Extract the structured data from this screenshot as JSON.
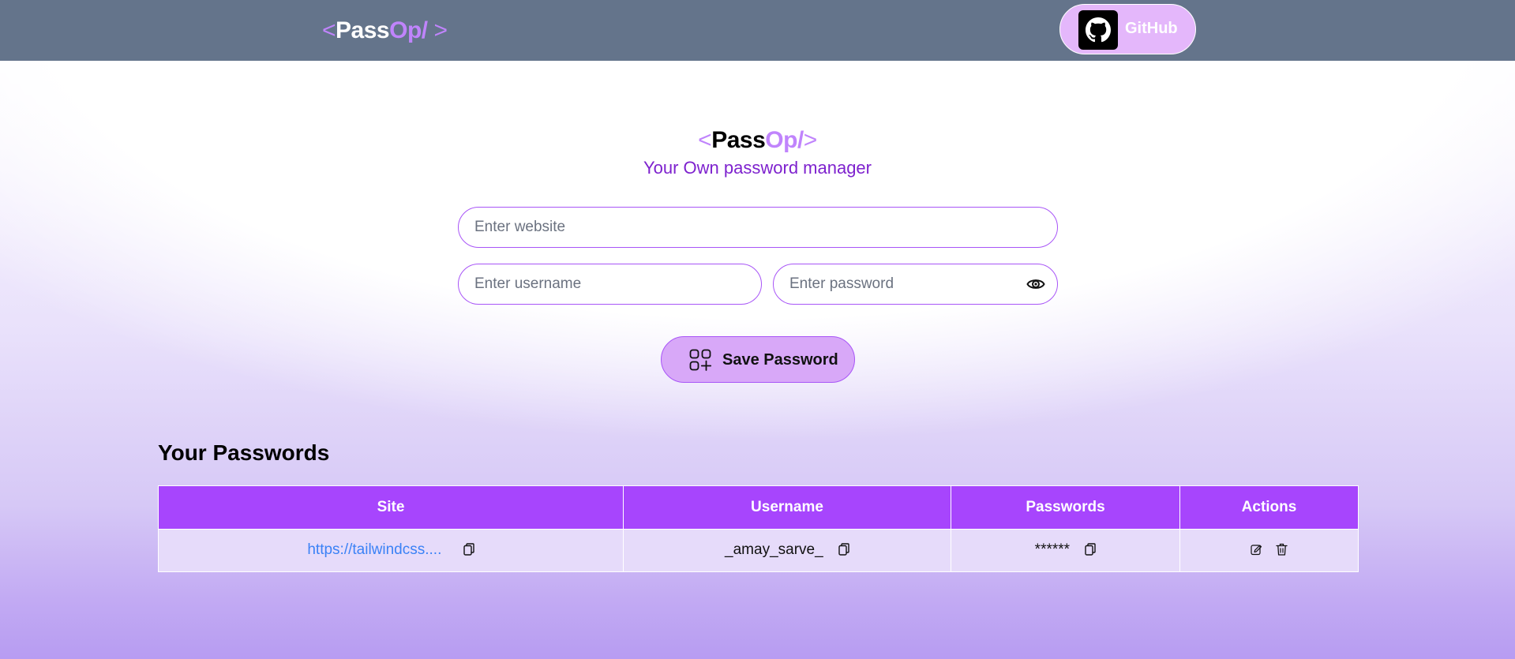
{
  "navbar": {
    "logo": {
      "open": "<",
      "pass": "Pass",
      "op": "Op/",
      "close": " >"
    },
    "github_label": "GitHub"
  },
  "hero": {
    "logo": {
      "open": "<",
      "pass": "Pass",
      "op": "Op/",
      "close": ">"
    },
    "tagline": "Your Own password manager"
  },
  "form": {
    "website_placeholder": "Enter website",
    "username_placeholder": "Enter username",
    "password_placeholder": "Enter password",
    "website_value": "",
    "username_value": "",
    "password_value": "",
    "save_label": "Save Password"
  },
  "passwords": {
    "title": "Your Passwords",
    "columns": [
      "Site",
      "Username",
      "Passwords",
      "Actions"
    ],
    "rows": [
      {
        "site": "https://tailwindcss....",
        "username": "_amay_sarve_",
        "password": "******"
      }
    ]
  },
  "icons": {
    "github": "github-icon",
    "eye": "eye-icon",
    "save": "add-grid-icon",
    "copy": "copy-icon",
    "edit": "edit-icon",
    "delete": "trash-icon"
  },
  "colors": {
    "navbar_bg": "#64748b",
    "accent": "#c084fc",
    "table_header_bg": "#a745fd",
    "table_row_bg": "#e6dbfa",
    "button_bg": "#d8a8f8",
    "link": "#3b82f6",
    "tagline": "#7e22ce"
  }
}
